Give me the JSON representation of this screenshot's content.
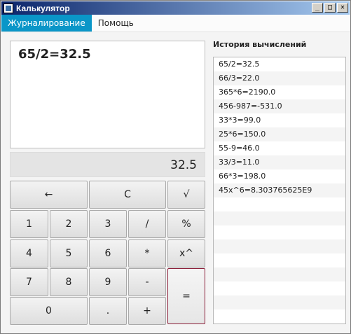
{
  "window": {
    "title": "Калькулятор",
    "min": "_",
    "max": "□",
    "close": "✕"
  },
  "menu": [
    {
      "label": "Журналирование",
      "active": true
    },
    {
      "label": "Помощь",
      "active": false
    }
  ],
  "display": {
    "expression": "65/2=32.5",
    "result": "32.5"
  },
  "keys": {
    "backspace": "←",
    "clear": "C",
    "sqrt": "√",
    "d1": "1",
    "d2": "2",
    "d3": "3",
    "div": "/",
    "pct": "%",
    "d4": "4",
    "d5": "5",
    "d6": "6",
    "mul": "*",
    "pow": "x^",
    "d7": "7",
    "d8": "8",
    "d9": "9",
    "sub": "-",
    "eq": "=",
    "d0": "0",
    "dot": ".",
    "add": "+"
  },
  "history": {
    "title": "История вычислений",
    "items": [
      "65/2=32.5",
      "66/3=22.0",
      "365*6=2190.0",
      "456-987=-531.0",
      "33*3=99.0",
      "25*6=150.0",
      "55-9=46.0",
      "33/3=11.0",
      "66*3=198.0",
      "45x^6=8.303765625E9"
    ]
  }
}
